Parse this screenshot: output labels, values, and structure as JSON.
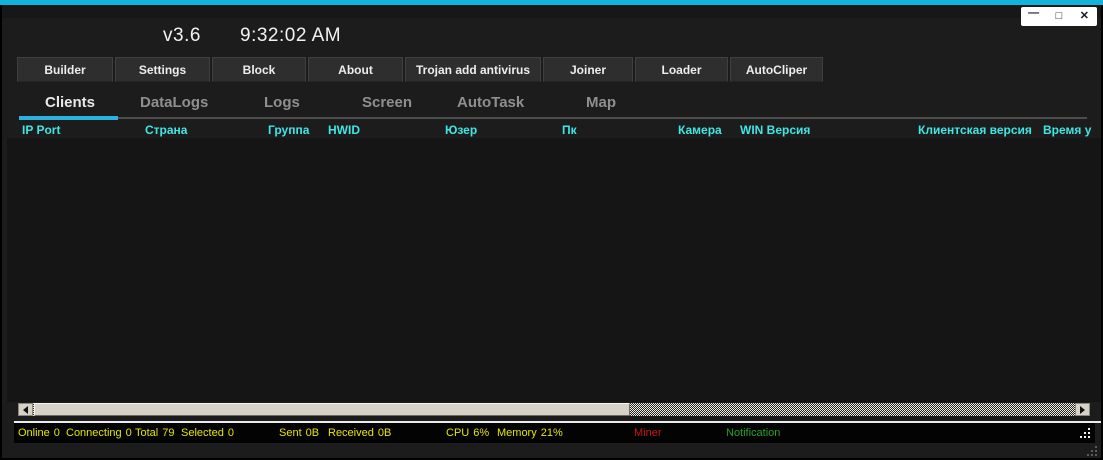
{
  "window": {
    "version": "v3.6",
    "clock": "9:32:02 AM",
    "controls": [
      {
        "name": "minimize-icon",
        "glyph": "—"
      },
      {
        "name": "maximize-icon",
        "glyph": "□"
      },
      {
        "name": "close-icon",
        "glyph": "✕"
      }
    ]
  },
  "toolbar": {
    "buttons": [
      {
        "label": "Builder"
      },
      {
        "label": "Settings"
      },
      {
        "label": "Block"
      },
      {
        "label": "About"
      },
      {
        "label": "Trojan add antivirus"
      },
      {
        "label": "Joiner"
      },
      {
        "label": "Loader"
      },
      {
        "label": "AutoCliper"
      }
    ]
  },
  "tabs": [
    {
      "label": "Clients",
      "active": true
    },
    {
      "label": "DataLogs",
      "active": false
    },
    {
      "label": "Logs",
      "active": false
    },
    {
      "label": "Screen",
      "active": false
    },
    {
      "label": "AutoTask",
      "active": false
    },
    {
      "label": "Map",
      "active": false
    }
  ],
  "clients_table": {
    "columns": [
      "IP Port",
      "Страна",
      "Группа",
      "HWID",
      "Юзер",
      "Пк",
      "Камера",
      "WIN Версия",
      "Клиентская версия",
      "Время у"
    ],
    "rows": []
  },
  "status_bar": {
    "counters": [
      {
        "label": "Online",
        "value": "0"
      },
      {
        "label": "Connecting",
        "value": "0"
      },
      {
        "label": "Total",
        "value": "79"
      },
      {
        "label": "Selected",
        "value": "0"
      },
      {
        "label": "Sent",
        "value": "0B"
      },
      {
        "label": "Received",
        "value": "0B"
      },
      {
        "label": "CPU",
        "value": "6%"
      },
      {
        "label": "Memory",
        "value": "21%"
      }
    ],
    "miner": "Miner",
    "notification": "Notification"
  },
  "colors": {
    "accent_cyan": "#12b2da",
    "tab_underline": "#2bb1e0",
    "grid_header_text": "#3fe6e6",
    "status_yellow": "#e6e600",
    "miner_red": "#cc1414",
    "notification_green": "#28a228"
  }
}
